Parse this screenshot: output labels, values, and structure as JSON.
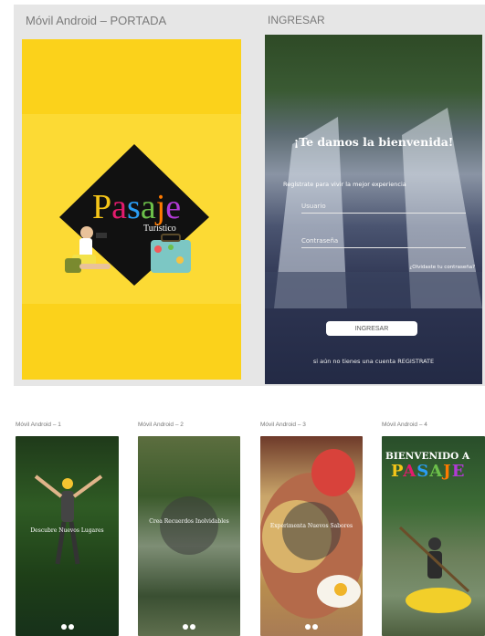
{
  "frames": {
    "portada_label": "Móvil Android – PORTADA",
    "ingresar_label": "INGRESAR"
  },
  "logo": {
    "word": [
      "P",
      "a",
      "s",
      "a",
      "j",
      "e"
    ],
    "letter_colors": [
      "#f5c518",
      "#e31b6d",
      "#2a9df4",
      "#6cc04a",
      "#ff7a00",
      "#b23ad6"
    ],
    "sub": "Turistico"
  },
  "login": {
    "welcome": "¡Te damos la bienvenida!",
    "subtitle": "Regístrate para vivir la mejor experiencia",
    "user_placeholder": "Usuario",
    "pass_placeholder": "Contraseña",
    "forgot": "¿Olvidaste tu contraseña?",
    "login_button": "INGRESAR",
    "register": "si aún no tienes una cuenta REGISTRATE"
  },
  "slides": [
    {
      "label": "Móvil Android – 1",
      "caption": "Descubre Nuevos Lugares"
    },
    {
      "label": "Móvil Android – 2",
      "caption": "Crea Recuerdos Inolvidables"
    },
    {
      "label": "Móvil Android – 3",
      "caption": "Experimenta Nuevos Sabores"
    },
    {
      "label": "Móvil Android – 4",
      "welcome": "BIENVENIDO A",
      "brand": [
        "P",
        "A",
        "S",
        "A",
        "J",
        "E"
      ]
    }
  ]
}
